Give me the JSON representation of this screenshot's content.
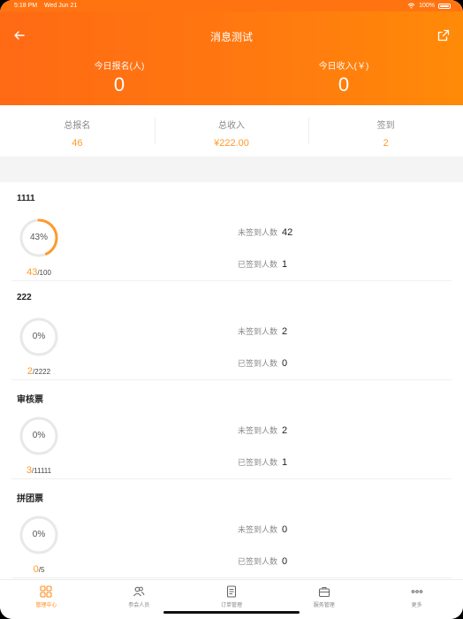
{
  "status": {
    "time": "5:18 PM",
    "date": "Wed Jun 21",
    "battery": "100%"
  },
  "header": {
    "title": "消息测试",
    "today_signup_label": "今日报名(人)",
    "today_signup_value": "0",
    "today_income_label": "今日收入(￥)",
    "today_income_value": "0"
  },
  "summary": {
    "total_signup_label": "总报名",
    "total_signup_value": "46",
    "total_income_label": "总收入",
    "total_income_value": "¥222.00",
    "checkin_label": "签到",
    "checkin_value": "2"
  },
  "tickets": [
    {
      "name": "1111",
      "percent": "43%",
      "progress": 0.43,
      "done": "43",
      "total": "/100",
      "unchecked_label": "未签到人数",
      "unchecked": "42",
      "checked_label": "已签到人数",
      "checked": "1"
    },
    {
      "name": "222",
      "percent": "0%",
      "progress": 0,
      "done": "2",
      "total": "/2222",
      "unchecked_label": "未签到人数",
      "unchecked": "2",
      "checked_label": "已签到人数",
      "checked": "0"
    },
    {
      "name": "审核票",
      "percent": "0%",
      "progress": 0,
      "done": "3",
      "total": "/11111",
      "unchecked_label": "未签到人数",
      "unchecked": "2",
      "checked_label": "已签到人数",
      "checked": "1"
    },
    {
      "name": "拼团票",
      "percent": "0%",
      "progress": 0,
      "done": "0",
      "total": "/5",
      "unchecked_label": "未签到人数",
      "unchecked": "0",
      "checked_label": "已签到人数",
      "checked": "0"
    }
  ],
  "tabbar": {
    "items": [
      {
        "label": "管理中心",
        "icon": "grid-icon",
        "active": true
      },
      {
        "label": "参会人员",
        "icon": "people-icon",
        "active": false
      },
      {
        "label": "订单管理",
        "icon": "document-icon",
        "active": false
      },
      {
        "label": "服务管理",
        "icon": "briefcase-icon",
        "active": false
      },
      {
        "label": "更多",
        "icon": "more-icon",
        "active": false
      }
    ]
  },
  "colors": {
    "accent": "#ff7411",
    "highlight": "#ff9a2a",
    "ring_track": "#e8e8e8"
  }
}
